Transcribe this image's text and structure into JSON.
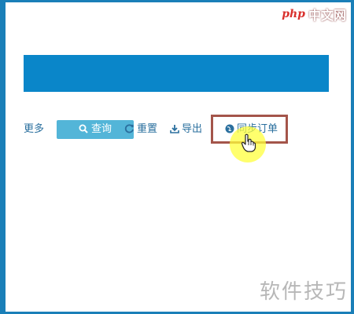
{
  "toolbar": {
    "more_label": "更多",
    "query_label": "查询",
    "reset_label": "重置",
    "export_label": "导出",
    "sync_orders_label": "同步订单"
  },
  "branding": {
    "site_logo_mark": "php",
    "site_logo_text": "中文网",
    "watermark_text": "软件技巧"
  },
  "colors": {
    "frame_border": "#1a7fb8",
    "header_bar": "#0a86c9",
    "query_button": "#53b5d8",
    "link_text": "#2a6f9e",
    "highlight_box": "#a4554a",
    "cursor_halo": "#ffff3c"
  },
  "icons": {
    "query": "search-icon",
    "reset": "refresh-icon",
    "export": "download-icon",
    "sync": "globe-icon",
    "pointer": "hand-cursor-icon"
  }
}
